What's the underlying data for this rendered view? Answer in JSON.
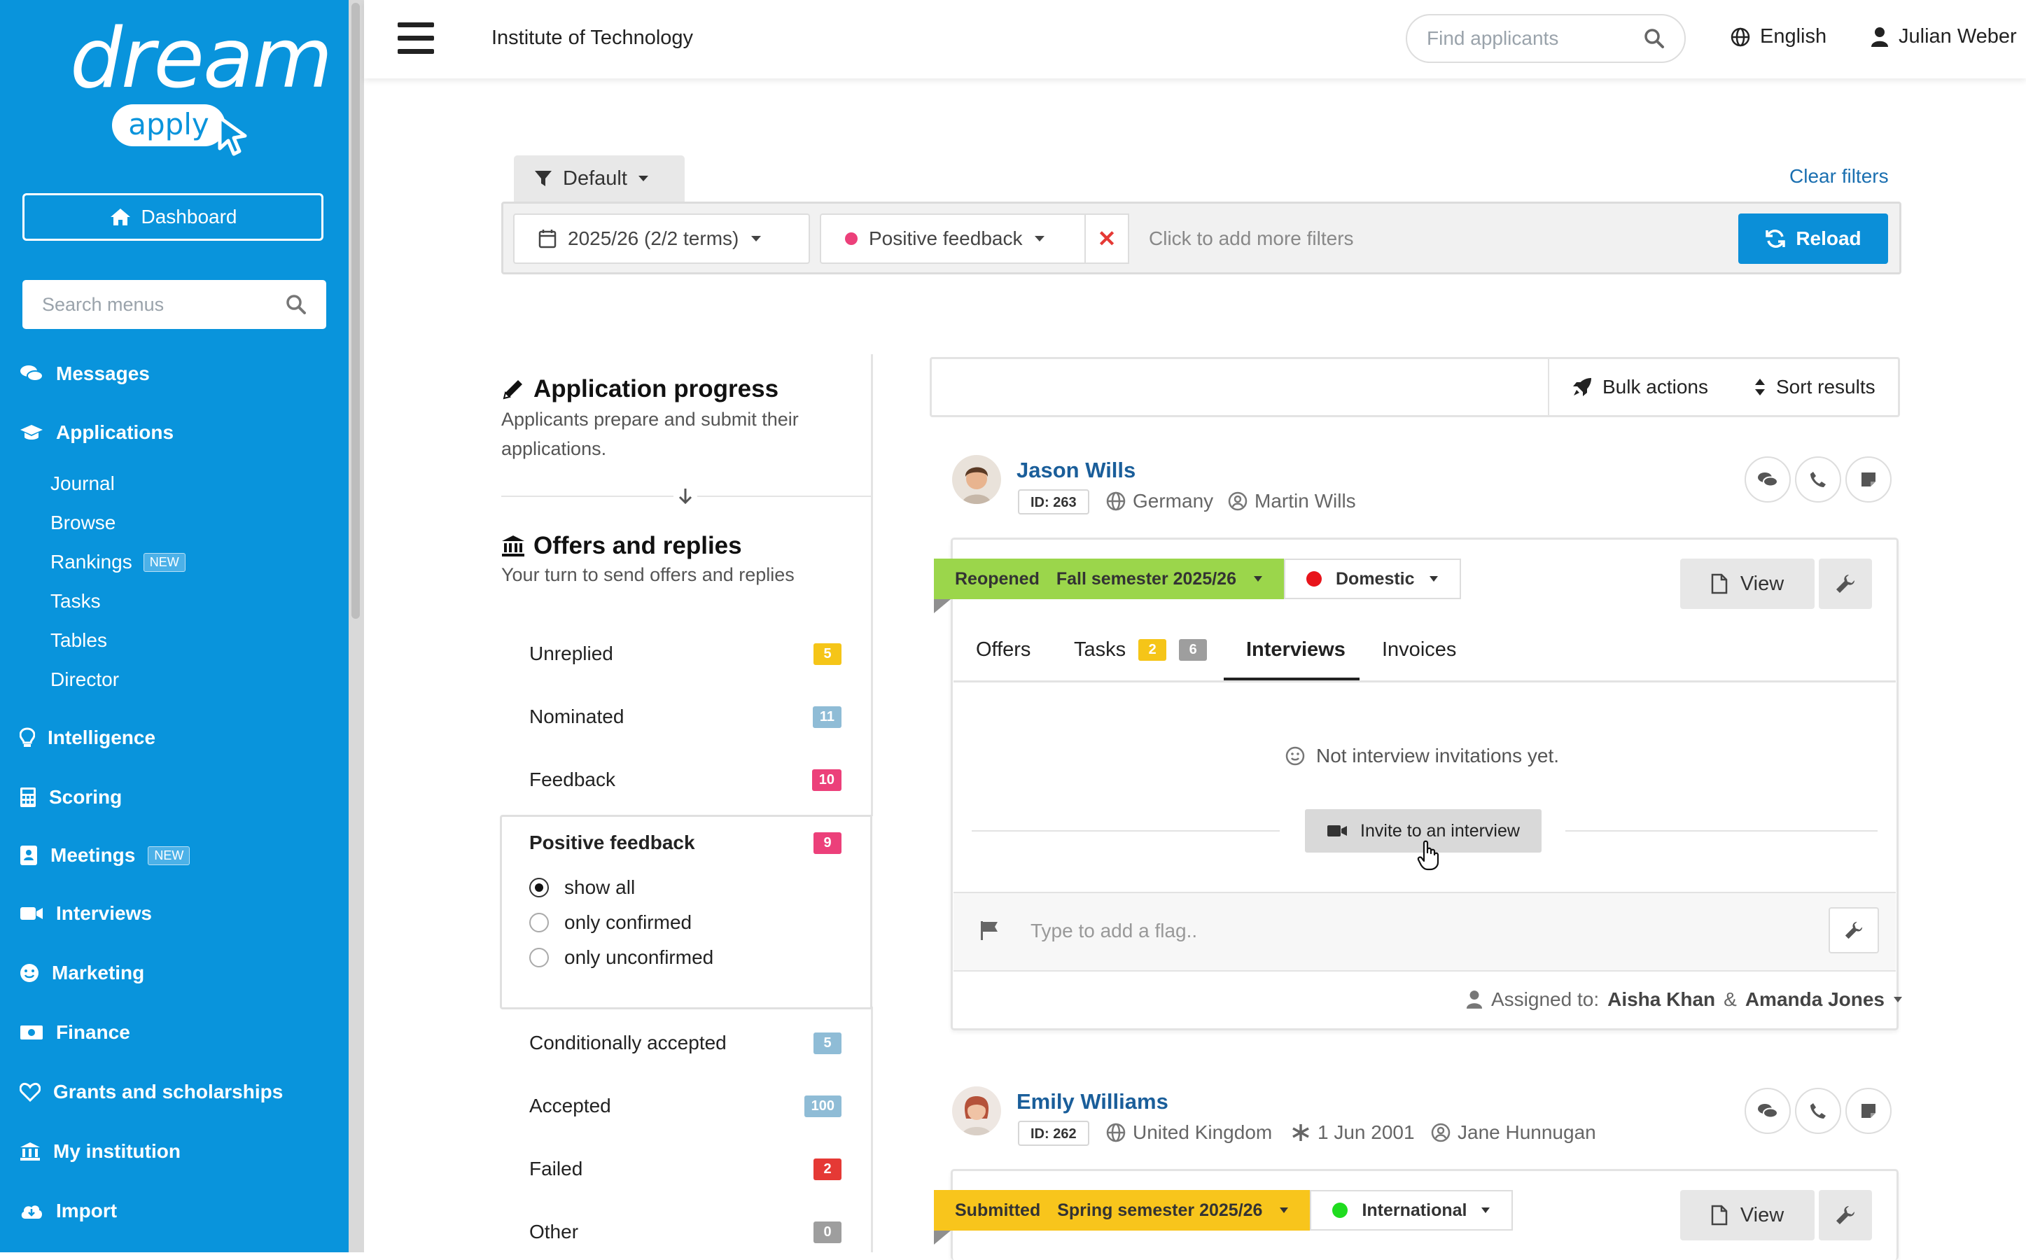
{
  "brand": {
    "logo_main": "dream",
    "logo_sub": "apply"
  },
  "sidebar": {
    "dashboard_label": "Dashboard",
    "search_placeholder": "Search menus",
    "messages": "Messages",
    "applications": "Applications",
    "sub_items": [
      {
        "label": "Journal"
      },
      {
        "label": "Browse"
      },
      {
        "label": "Rankings",
        "badge": "NEW"
      },
      {
        "label": "Tasks"
      },
      {
        "label": "Tables"
      },
      {
        "label": "Director"
      }
    ],
    "intelligence": "Intelligence",
    "scoring": "Scoring",
    "meetings": "Meetings",
    "meetings_badge": "NEW",
    "interviews": "Interviews",
    "marketing": "Marketing",
    "finance": "Finance",
    "grants": "Grants and scholarships",
    "my_institution": "My institution",
    "import": "Import"
  },
  "topbar": {
    "institution": "Institute of Technology",
    "find_placeholder": "Find applicants",
    "language": "English",
    "user": "Julian Weber"
  },
  "filters": {
    "preset": "Default",
    "clear": "Clear filters",
    "term": "2025/26 (2/2 terms)",
    "feedback": "Positive feedback",
    "add_more": "Click to add more filters",
    "reload": "Reload"
  },
  "stages": {
    "progress_title": "Application progress",
    "progress_desc": "Applicants prepare and submit their applications.",
    "offers_title": "Offers and replies",
    "offers_desc": "Your turn to send offers and replies"
  },
  "categories": {
    "unreplied": {
      "label": "Unreplied",
      "count": "5",
      "color": "#f5c518"
    },
    "nominated": {
      "label": "Nominated",
      "count": "11",
      "color": "#8fbcd6"
    },
    "feedback": {
      "label": "Feedback",
      "count": "10",
      "color": "#ec407a"
    },
    "positive": {
      "label": "Positive feedback",
      "count": "9",
      "color": "#ec407a"
    },
    "cond": {
      "label": "Conditionally accepted",
      "count": "5",
      "color": "#8fbcd6"
    },
    "accepted": {
      "label": "Accepted",
      "count": "100",
      "color": "#8fbcd6"
    },
    "failed": {
      "label": "Failed",
      "count": "2",
      "color": "#e53935"
    },
    "other": {
      "label": "Other",
      "count": "0",
      "color": "#9e9e9e"
    }
  },
  "radios": {
    "all": "show all",
    "confirmed": "only confirmed",
    "unconfirmed": "only unconfirmed"
  },
  "results": {
    "bulk": "Bulk actions",
    "sort": "Sort results"
  },
  "applicants": [
    {
      "name": "Jason Wills",
      "id": "ID: 263",
      "country": "Germany",
      "contact": "Martin Wills",
      "status": "Reopened",
      "term": "Fall semester 2025/26",
      "type": "Domestic",
      "type_color": "#e8141b",
      "status_color": "#9bd64b",
      "view": "View",
      "tabs": {
        "offers": "Offers",
        "tasks": "Tasks",
        "tasks_count_a": "2",
        "tasks_count_b": "6",
        "interviews": "Interviews",
        "invoices": "Invoices"
      },
      "empty": "Not interview invitations yet.",
      "invite": "Invite to an interview",
      "flag_placeholder": "Type to add a flag..",
      "assigned_label": "Assigned to:",
      "assignee_a": "Aisha Khan",
      "assignee_amp": "&",
      "assignee_b": "Amanda Jones"
    },
    {
      "name": "Emily Williams",
      "id": "ID: 262",
      "country": "United Kingdom",
      "birth": "1 Jun 2001",
      "contact": "Jane Hunnugan",
      "status": "Submitted",
      "term": "Spring semester 2025/26",
      "type": "International",
      "type_color": "#1fdc1f",
      "status_color": "#f8c51c",
      "view": "View"
    }
  ]
}
